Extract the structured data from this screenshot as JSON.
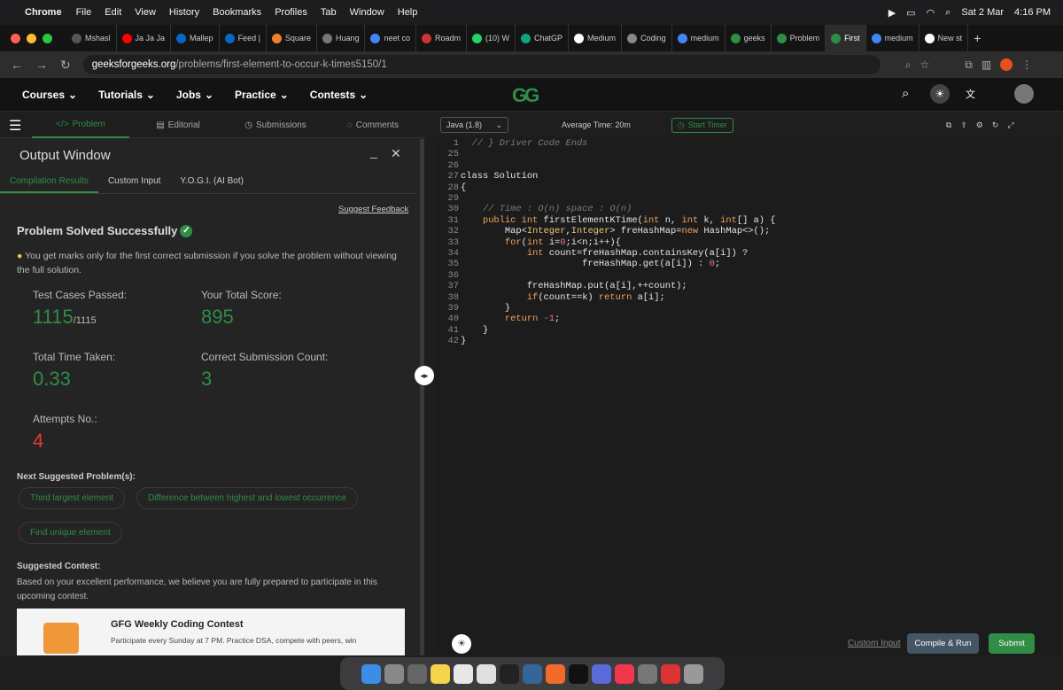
{
  "menubar": {
    "app": "Chrome",
    "items": [
      "File",
      "Edit",
      "View",
      "History",
      "Bookmarks",
      "Profiles",
      "Tab",
      "Window",
      "Help"
    ],
    "date": "Sat 2 Mar",
    "time": "4:16 PM"
  },
  "tabs": [
    "Mshasl",
    "Ja Ja Ja",
    "Mallep",
    "Feed |",
    "Square",
    "Huang",
    "neet co",
    "Roadm",
    "(10) W",
    "ChatGP",
    "Medium",
    "Coding",
    "medium",
    "geeks",
    "Problem",
    "First",
    "medium",
    "New st"
  ],
  "url": {
    "host": "geeksforgeeks.org",
    "path": "/problems/first-element-to-occur-k-times5150/1"
  },
  "site": {
    "nav": [
      "Courses",
      "Tutorials",
      "Jobs",
      "Practice",
      "Contests"
    ],
    "logo": "GG"
  },
  "left_tabs": [
    "Problem",
    "Editorial",
    "Submissions",
    "Comments"
  ],
  "output": {
    "title": "Output Window",
    "tabs": [
      "Compilation Results",
      "Custom Input",
      "Y.O.G.I. (AI Bot)"
    ],
    "feedback": "Suggest Feedback",
    "status": "Problem Solved Successfully",
    "tip": "You get marks only for the first correct submission if you solve the problem without viewing the full solution.",
    "tests_label": "Test Cases Passed:",
    "tests_value": "1115",
    "tests_total": "/1115",
    "score_label": "Your Total Score:",
    "score_value": "895",
    "time_label": "Total Time Taken:",
    "time_value": "0.33",
    "count_label": "Correct Submission Count:",
    "count_value": "3",
    "attempts_label": "Attempts No.:",
    "attempts_value": "4",
    "next_label": "Next Suggested Problem(s):",
    "next": [
      "Third largest element",
      "Difference between highest and lowest occurrence",
      "Find unique element"
    ],
    "contest_label": "Suggested Contest:",
    "contest_text": "Based on your excellent performance, we believe you are fully prepared to participate in this upcoming contest.",
    "contest_title": "GFG Weekly Coding Contest",
    "contest_desc": "Participate every Sunday at 7 PM. Practice DSA, compete with peers, win"
  },
  "editor": {
    "language": "Java (1.8)",
    "avg_time": "Average Time: 20m",
    "timer": "Start Timer",
    "custom_input": "Custom Input",
    "compile": "Compile & Run",
    "submit": "Submit"
  }
}
